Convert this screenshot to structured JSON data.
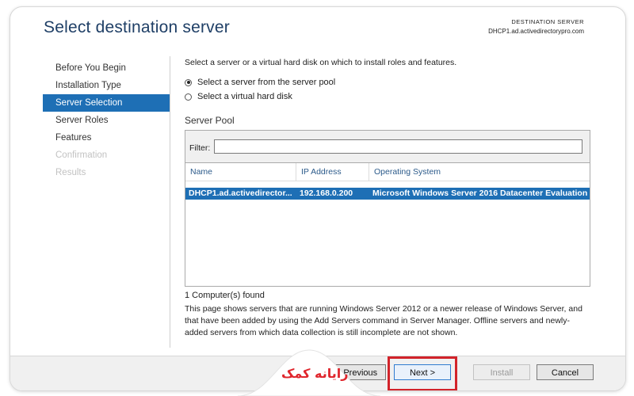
{
  "header": {
    "title": "Select destination server",
    "destination_label": "DESTINATION SERVER",
    "destination_server": "DHCP1.ad.activedirectorypro.com"
  },
  "nav": {
    "items": [
      {
        "label": "Before You Begin",
        "state": "normal"
      },
      {
        "label": "Installation Type",
        "state": "normal"
      },
      {
        "label": "Server Selection",
        "state": "active"
      },
      {
        "label": "Server Roles",
        "state": "normal"
      },
      {
        "label": "Features",
        "state": "normal"
      },
      {
        "label": "Confirmation",
        "state": "disabled"
      },
      {
        "label": "Results",
        "state": "disabled"
      }
    ]
  },
  "main": {
    "intro": "Select a server or a virtual hard disk on which to install roles and features.",
    "radio_pool": "Select a server from the server pool",
    "radio_vhd": "Select a virtual hard disk",
    "pool_heading": "Server Pool",
    "filter_label": "Filter:",
    "filter_value": "",
    "columns": {
      "name": "Name",
      "ip": "IP Address",
      "os": "Operating System"
    },
    "row": {
      "name": "DHCP1.ad.activedirector...",
      "ip": "192.168.0.200",
      "os": "Microsoft Windows Server 2016 Datacenter Evaluation"
    },
    "found": "1 Computer(s) found",
    "description": "This page shows servers that are running Windows Server 2012 or a newer release of Windows Server, and that have been added by using the Add Servers command in Server Manager. Offline servers and newly-added servers from which data collection is still incomplete are not shown."
  },
  "footer": {
    "previous_label": "< Previous",
    "next_label": "Next >",
    "install_label": "Install",
    "cancel_label": "Cancel"
  },
  "watermark": {
    "logo_text": "رایانه کمک"
  },
  "colors": {
    "accent": "#1e6fb5",
    "highlight": "#d2232a",
    "title": "#1f3f66"
  }
}
